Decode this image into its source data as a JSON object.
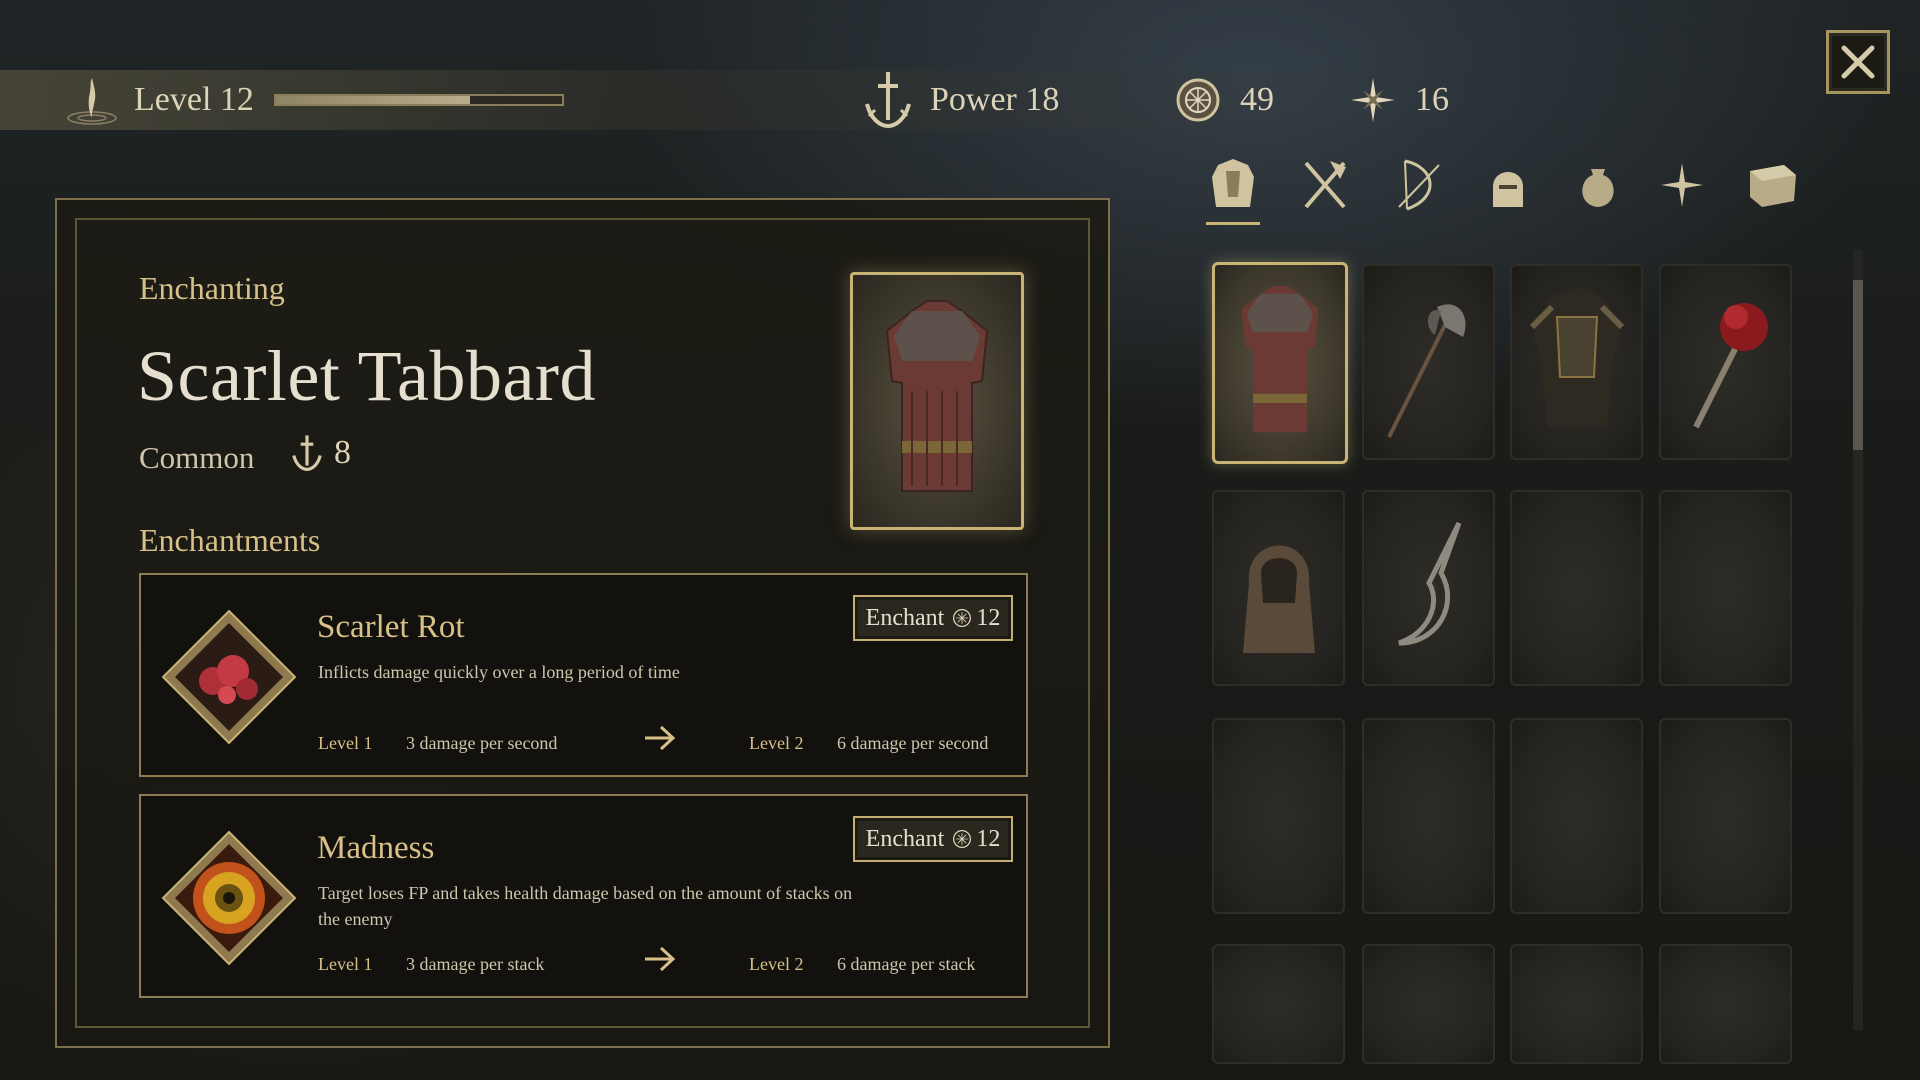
{
  "hud": {
    "level_label": "Level 12",
    "level_progress": 0.68,
    "power_label": "Power 18",
    "coins": "49",
    "stars": "16"
  },
  "panel": {
    "section_label": "Enchanting",
    "item_name": "Scarlet Tabbard",
    "rarity": "Common",
    "item_power": "8",
    "enchantments_label": "Enchantments"
  },
  "enchantments": [
    {
      "name": "Scarlet Rot",
      "description": "Inflicts damage quickly over a long period of time",
      "button_label": "Enchant",
      "cost": "12",
      "from_level": "Level 1",
      "from_value": "3 damage per second",
      "to_level": "Level 2",
      "to_value": "6 damage per second",
      "gem_color": "#b0303a"
    },
    {
      "name": "Madness",
      "description": "Target loses FP and takes health damage based on the amount of stacks on the enemy",
      "button_label": "Enchant",
      "cost": "12",
      "from_level": "Level 1",
      "from_value": "3 damage per stack",
      "to_level": "Level 2",
      "to_value": "6 damage per stack",
      "gem_color": "#d7a321"
    }
  ],
  "tabs": [
    "armor-tab",
    "axes-tab",
    "bows-tab",
    "helmets-tab",
    "consumables-tab",
    "spells-tab",
    "misc-tab"
  ],
  "inventory": [
    "tabard",
    "halberd",
    "dark-armor",
    "flail",
    "hood",
    "sickle-chain",
    "empty",
    "empty",
    "empty",
    "empty",
    "empty",
    "empty",
    "empty",
    "empty",
    "empty",
    "empty"
  ],
  "colors": {
    "accent_gold": "#c9b476",
    "title_gold": "#d8c089",
    "text": "#cfc6ad"
  }
}
